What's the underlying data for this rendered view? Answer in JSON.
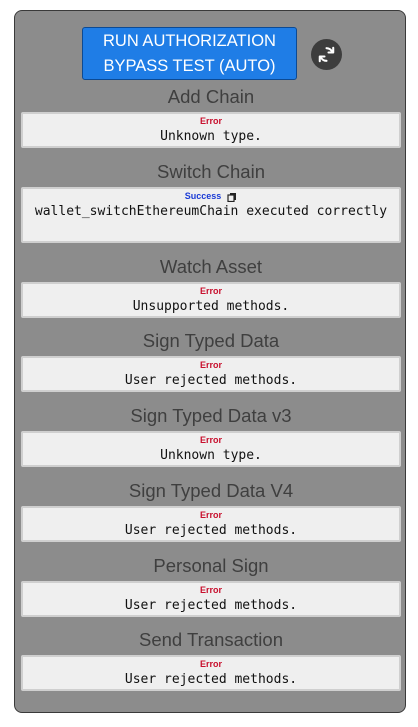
{
  "run_button": {
    "label": "RUN AUTHORIZATION BYPASS TEST (AUTO)"
  },
  "refresh_button": {
    "icon": "refresh-icon"
  },
  "colors": {
    "panel_bg": "#8c8c8c",
    "run_button_bg": "#1f7de6",
    "error": "#c8102e",
    "success": "#1a3bd6"
  },
  "sections": [
    {
      "title": "Add Chain",
      "status": "Error",
      "message": "Unknown type."
    },
    {
      "title": "Switch Chain",
      "status": "Success",
      "message": "wallet_switchEthereumChain executed correctly",
      "status_icon": "copy-icon"
    },
    {
      "title": "Watch Asset",
      "status": "Error",
      "message": "Unsupported methods."
    },
    {
      "title": "Sign Typed Data",
      "status": "Error",
      "message": "User rejected methods."
    },
    {
      "title": "Sign Typed Data v3",
      "status": "Error",
      "message": "Unknown type."
    },
    {
      "title": "Sign Typed Data V4",
      "status": "Error",
      "message": "User rejected methods."
    },
    {
      "title": "Personal Sign",
      "status": "Error",
      "message": "User rejected methods."
    },
    {
      "title": "Send Transaction",
      "status": "Error",
      "message": "User rejected methods."
    }
  ]
}
